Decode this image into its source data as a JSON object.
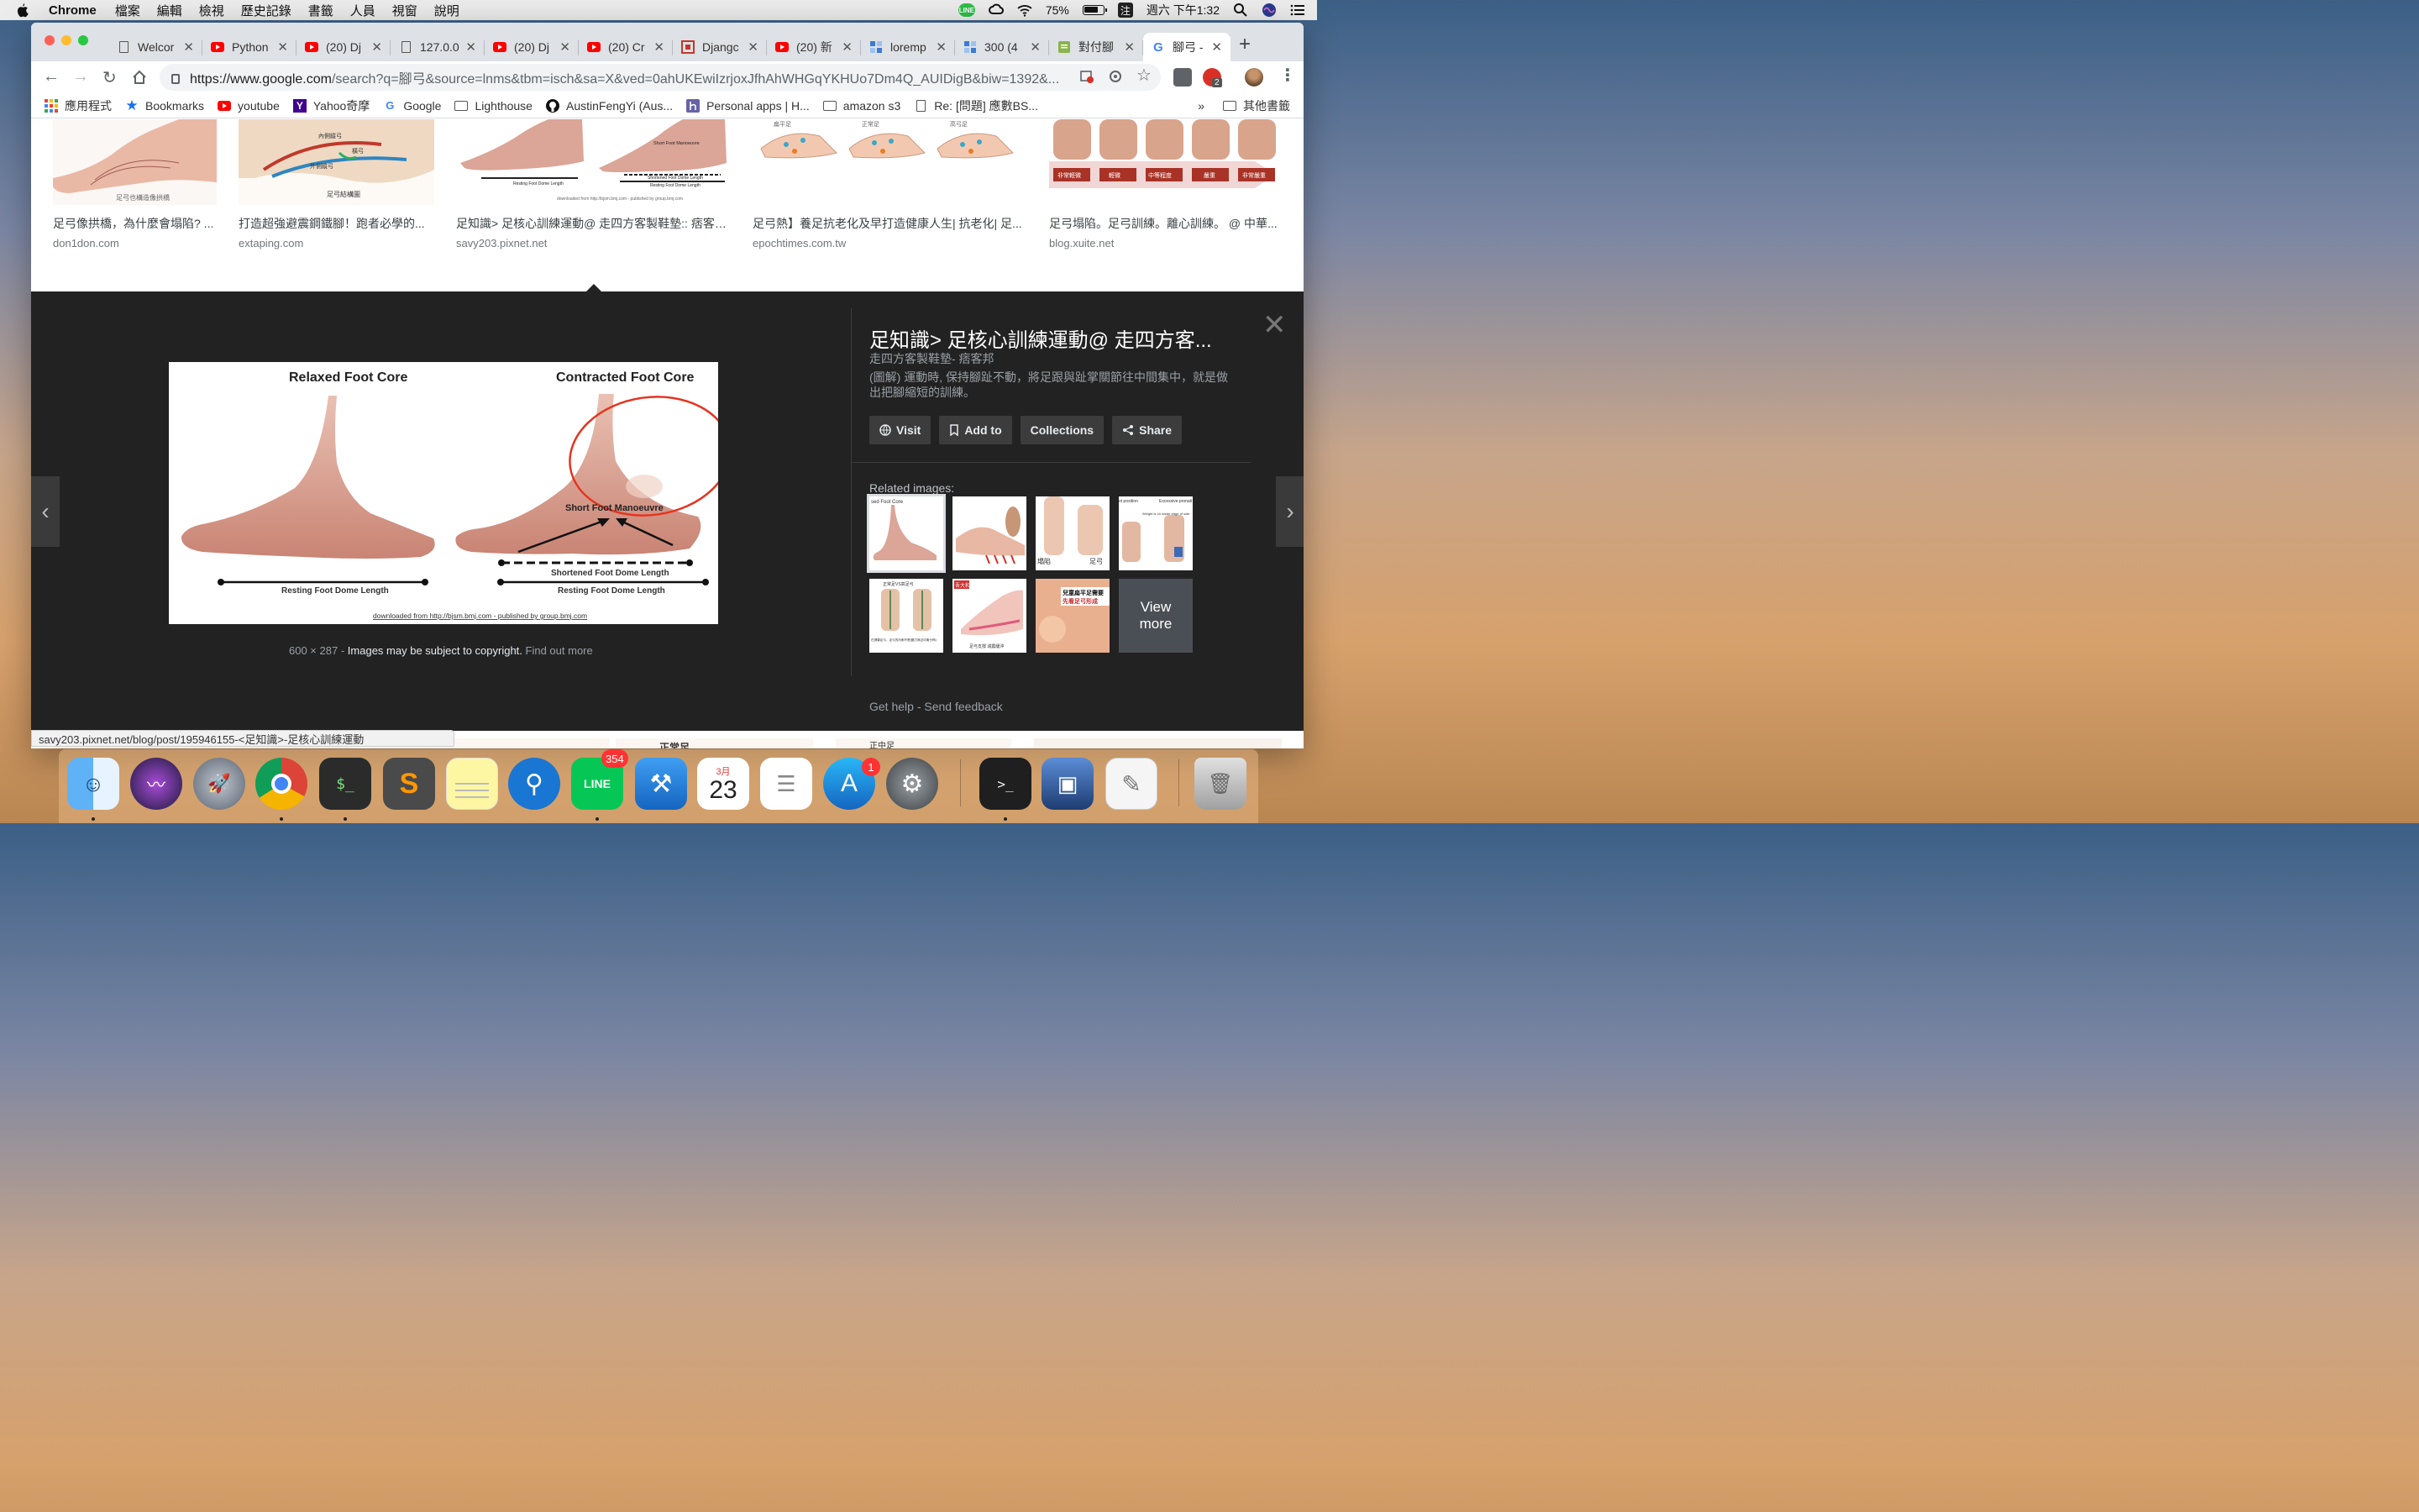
{
  "menubar": {
    "app_name": "Chrome",
    "menus": [
      "檔案",
      "編輯",
      "檢視",
      "歷史記錄",
      "書籤",
      "人員",
      "視窗",
      "說明"
    ],
    "battery": "75%",
    "ime": "注",
    "line_label": "LINE",
    "clock": "週六 下午1:32"
  },
  "tabs": [
    {
      "title": "Welcor",
      "icon": "document-icon"
    },
    {
      "title": "Python",
      "icon": "youtube-icon"
    },
    {
      "title": "(20) Dj",
      "icon": "youtube-icon"
    },
    {
      "title": "127.0.0",
      "icon": "document-icon"
    },
    {
      "title": "(20) Dj",
      "icon": "youtube-icon"
    },
    {
      "title": "(20) Cr",
      "icon": "youtube-icon"
    },
    {
      "title": "Djangc",
      "icon": "django-icon"
    },
    {
      "title": "(20) 新",
      "icon": "youtube-icon"
    },
    {
      "title": "loremp",
      "icon": "grid-icon"
    },
    {
      "title": "300 (4",
      "icon": "grid-icon"
    },
    {
      "title": "對付腳",
      "icon": "doc-green-icon"
    },
    {
      "title": "腳弓 -",
      "icon": "google-icon",
      "active": true
    }
  ],
  "toolbar": {
    "url_host": "https://www.google.com",
    "url_path": "/search?q=腳弓&source=lnms&tbm=isch&sa=X&ved=0ahUKEwiIzrjoxJfhAhWHGqYKHUo7Dm4Q_AUIDigB&biw=1392&...",
    "extension_badge": "2"
  },
  "bookmarks": {
    "items": [
      {
        "label": "應用程式",
        "icon": "apps-grid-icon"
      },
      {
        "label": "Bookmarks",
        "icon": "star-icon"
      },
      {
        "label": "youtube",
        "icon": "youtube-icon"
      },
      {
        "label": "Yahoo奇摩",
        "icon": "yahoo-icon"
      },
      {
        "label": "Google",
        "icon": "google-icon"
      },
      {
        "label": "Lighthouse",
        "icon": "folder-icon"
      },
      {
        "label": "AustinFengYi (Aus...",
        "icon": "github-icon"
      },
      {
        "label": "Personal apps | H...",
        "icon": "heroku-icon"
      },
      {
        "label": "amazon s3",
        "icon": "folder-icon"
      },
      {
        "label": "Re: [問題] 應數BS...",
        "icon": "document-icon"
      }
    ],
    "overflow": "»",
    "other": "其他書籤"
  },
  "results": [
    {
      "title": "足弓像拱橋，為什麼會塌陷? ...",
      "source": "don1don.com",
      "caption": "足弓也構造像拱橋"
    },
    {
      "title": "打造超強避震鋼鐵腳！跑者必學的...",
      "source": "extaping.com",
      "caption": "足弓結構圖"
    },
    {
      "title": "足知識> 足核心訓練運動@ 走四方客製鞋墊:: 痞客邦::",
      "source": "savy203.pixnet.net",
      "caption": "Short Foot Manoeuvre"
    },
    {
      "title": "足弓熱】養足抗老化及早打造健康人生| 抗老化| 足...",
      "source": "epochtimes.com.tw",
      "caption": ""
    },
    {
      "title": "足弓塌陷。足弓訓練。離心訓練。 @ 中華...",
      "source": "blog.xuite.net",
      "caption": ""
    }
  ],
  "result_labels": {
    "r2_arch1": "內側縱弓",
    "r2_arch2": "橫弓",
    "r2_arch3": "外側縱弓",
    "r3_short": "Short Foot Manoeuvre",
    "r3_shortened": "Shortened Foot Dome Length",
    "r3_resting": "Resting Foot Dome Length",
    "r3_credit": "downloaded from http://bjsm.bmj.com - published by group.bmj.com",
    "r4_top1": "扁平足",
    "r4_top2": "正常足",
    "r4_top3": "高弓足",
    "r5_grades": [
      "非常輕微",
      "輕微",
      "中等程度",
      "嚴重",
      "非常嚴重"
    ]
  },
  "preview": {
    "title": "足知識> 足核心訓練運動@ 走四方客...",
    "site": "走四方客製鞋墊- 痞客邦",
    "description": "(圖解) 運動時, 保持腳趾不動，將足跟與趾掌關節往中間集中，就是做出把腳縮短的訓練。",
    "image": {
      "left_title": "Relaxed Foot Core",
      "right_title": "Contracted Foot Core",
      "manoeuvre": "Short Foot Manoeuvre",
      "shortened": "Shortened Foot Dome Length",
      "resting_left": "Resting Foot Dome Length",
      "resting_right": "Resting Foot Dome Length",
      "credit": "downloaded from http://bjsm.bmj.com - published by group.bmj.com"
    },
    "dimensions": "600 × 287",
    "separator": "-",
    "copyright": "Images may be subject to copyright.",
    "find_out_more": "Find out more",
    "buttons": {
      "visit": "Visit",
      "add_to": "Add to",
      "collections": "Collections",
      "share": "Share"
    },
    "related_label": "Related images:",
    "related": [
      {
        "caption": "sed Foot Core",
        "accent": "#d9a08c"
      },
      {
        "caption": "",
        "accent": "#e0a080"
      },
      {
        "caption": "塌陷",
        "caption2": "足弓",
        "accent": "#e8c2a8"
      },
      {
        "caption": "ot position",
        "caption2": "Excessive pronati",
        "caption3": "Weight is on inside edge of sole",
        "accent": "#d8b098"
      },
      {
        "caption": "正常足VS高足弓",
        "caption2": "在健康足弓，足弓的內側不是(壓力無法均衡分佈)",
        "accent": "#c8a890"
      },
      {
        "caption": "足弓支撐 減震緩沖",
        "caption2": "吾大和",
        "accent": "#f0c8c0"
      },
      {
        "caption": "兒童扁平足需要",
        "caption2": "先看足弓形成",
        "accent": "#e9b090"
      }
    ],
    "view_more_1": "View",
    "view_more_2": "more",
    "help": "Get help",
    "help_sep": "-",
    "feedback": "Send feedback"
  },
  "below_labels": {
    "c1": "正常足",
    "c2": "正中足"
  },
  "status_url": "savy203.pixnet.net/blog/post/195946155-<足知識>-足核心訓練運動",
  "dock": {
    "line_badge": "354",
    "appstore_badge": "1",
    "calendar_month": "3月",
    "calendar_day": "23",
    "line_label": "LINE"
  }
}
